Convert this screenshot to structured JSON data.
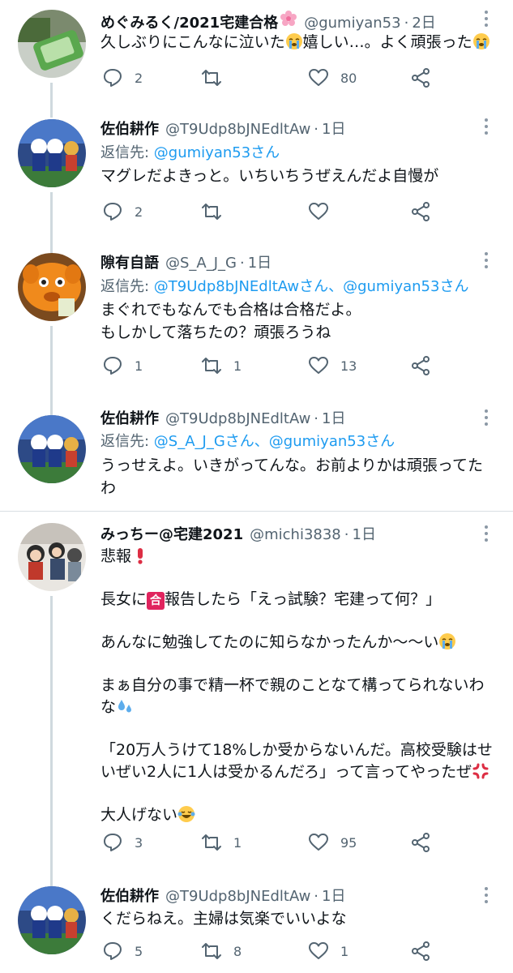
{
  "tweets": [
    {
      "name": "めぐみるく/2021宅建合格",
      "handle": "@gumiyan53",
      "dot": "·",
      "time": "2日",
      "reply_prefix": "",
      "reply_mentions": "",
      "lines": [
        "久しぶりにこんなに泣いた",
        "嬉しい…。よく頑張った"
      ],
      "counts": {
        "reply": "2",
        "retweet": "",
        "like": "80"
      }
    },
    {
      "name": "佐伯耕作",
      "handle": "@T9Udp8bJNEdltAw",
      "dot": "·",
      "time": "1日",
      "reply_prefix": "返信先: ",
      "reply_mentions": "@gumiyan53さん",
      "lines": [
        "マグレだよきっと。いちいちうぜえんだよ自慢が"
      ],
      "counts": {
        "reply": "2",
        "retweet": "",
        "like": ""
      }
    },
    {
      "name": "隙有自語",
      "handle": "@S_A_J_G",
      "dot": "·",
      "time": "1日",
      "reply_prefix": "返信先: ",
      "reply_mentions": "@T9Udp8bJNEdltAwさん、@gumiyan53さん",
      "lines": [
        "まぐれでもなんでも合格は合格だよ。",
        "もしかして落ちたの？頑張ろうね"
      ],
      "counts": {
        "reply": "1",
        "retweet": "1",
        "like": "13"
      }
    },
    {
      "name": "佐伯耕作",
      "handle": "@T9Udp8bJNEdltAw",
      "dot": "·",
      "time": "1日",
      "reply_prefix": "返信先: ",
      "reply_mentions": "@S_A_J_Gさん、@gumiyan53さん",
      "lines": [
        "うっせえよ。いきがってんな。お前よりかは頑張ってた",
        "わ"
      ],
      "counts": {
        "reply": "",
        "retweet": "",
        "like": ""
      }
    },
    {
      "name": "みっちー@宅建2021",
      "handle": "@michi3838",
      "dot": "·",
      "time": "1日",
      "reply_prefix": "",
      "reply_mentions": "",
      "lines": [
        "悲報",
        "長女に",
        "報告したら「えっ試験？宅建って何？」",
        "あんなに勉強してたのに知らなかったんか〜〜い",
        "まぁ自分の事で精一杯で親のことなて構ってられないわ",
        "な",
        "「20万人うけて18%しか受からないんだ。高校受験はせ",
        "いぜい2人に1人は受かるんだろ」って言ってやったぜ",
        "大人げない"
      ],
      "badge": "合",
      "counts": {
        "reply": "3",
        "retweet": "1",
        "like": "95"
      }
    },
    {
      "name": "佐伯耕作",
      "handle": "@T9Udp8bJNEdltAw",
      "dot": "·",
      "time": "1日",
      "reply_prefix": "",
      "reply_mentions": "",
      "lines": [
        "くだらねえ。主婦は気楽でいいよな"
      ],
      "counts": {
        "reply": "5",
        "retweet": "8",
        "like": "1"
      }
    }
  ],
  "icons": {
    "reply": "reply-icon",
    "retweet": "retweet-icon",
    "like": "like-icon",
    "share": "share-icon",
    "more": "more-icon"
  },
  "colors": {
    "text": "#0f1419",
    "secondary": "#536471",
    "mention": "#1d9bf0",
    "thread_line": "#cfd9de"
  }
}
